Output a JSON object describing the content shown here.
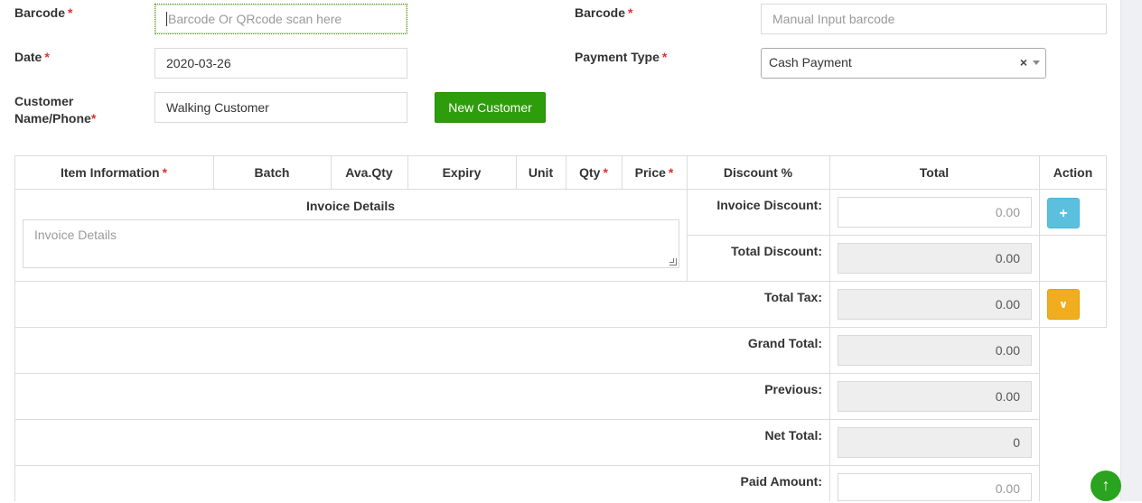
{
  "form": {
    "barcode_label": "Barcode",
    "barcode_placeholder": "Barcode Or QRcode scan here",
    "manual_barcode_label": "Barcode",
    "manual_barcode_placeholder": "Manual Input barcode",
    "date_label": "Date",
    "date_value": "2020-03-26",
    "payment_type_label": "Payment Type",
    "payment_type_value": "Cash Payment",
    "payment_clear": "×",
    "customer_label_line1": "Customer",
    "customer_label_line2": "Name/Phone",
    "customer_value": "Walking Customer",
    "new_customer_button": "New Customer",
    "required_mark": "*"
  },
  "table": {
    "headers": {
      "item_information": "Item Information",
      "batch": "Batch",
      "ava_qty": "Ava.Qty",
      "expiry": "Expiry",
      "unit": "Unit",
      "qty": "Qty",
      "price": "Price",
      "discount": "Discount %",
      "total": "Total",
      "action": "Action"
    },
    "invoice_details_title": "Invoice Details",
    "invoice_details_placeholder": "Invoice Details"
  },
  "summary": {
    "invoice_discount_label": "Invoice Discount:",
    "invoice_discount_value": "0.00",
    "total_discount_label": "Total Discount:",
    "total_discount_value": "0.00",
    "total_tax_label": "Total Tax:",
    "total_tax_value": "0.00",
    "grand_total_label": "Grand Total:",
    "grand_total_value": "0.00",
    "previous_label": "Previous:",
    "previous_value": "0.00",
    "net_total_label": "Net Total:",
    "net_total_value": "0",
    "paid_amount_label": "Paid Amount:",
    "paid_amount_value": "0.00"
  },
  "actions": {
    "add_icon": "plus-icon",
    "toggle_icon": "chevron-double-down-icon",
    "scroll_top_icon": "arrow-up-icon"
  },
  "colors": {
    "new_customer_button": "#2e9d0b",
    "add_button": "#5bc0de",
    "toggle_button": "#f0ad1e",
    "required": "#dd3333",
    "scroll_top": "#2aa31e"
  }
}
